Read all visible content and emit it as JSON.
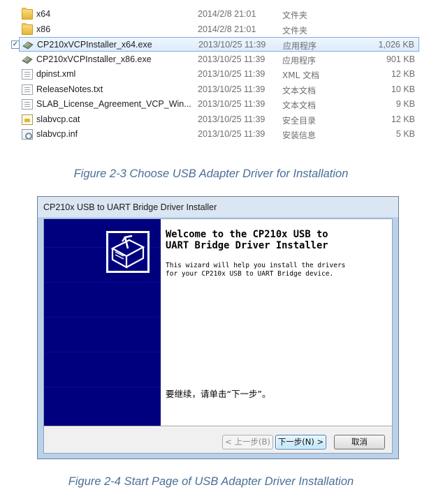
{
  "files": [
    {
      "name": "x64",
      "date": "2014/2/8 21:01",
      "type": "文件夹",
      "size": "",
      "icon": "folder-icon",
      "selected": false
    },
    {
      "name": "x86",
      "date": "2014/2/8 21:01",
      "type": "文件夹",
      "size": "",
      "icon": "folder-icon",
      "selected": false
    },
    {
      "name": "CP210xVCPInstaller_x64.exe",
      "date": "2013/10/25 11:39",
      "type": "应用程序",
      "size": "1,026 KB",
      "icon": "installer-exe-icon",
      "selected": true
    },
    {
      "name": "CP210xVCPInstaller_x86.exe",
      "date": "2013/10/25 11:39",
      "type": "应用程序",
      "size": "901 KB",
      "icon": "installer-exe-icon",
      "selected": false
    },
    {
      "name": "dpinst.xml",
      "date": "2013/10/25 11:39",
      "type": "XML 文档",
      "size": "12 KB",
      "icon": "xml-document-icon",
      "selected": false
    },
    {
      "name": "ReleaseNotes.txt",
      "date": "2013/10/25 11:39",
      "type": "文本文档",
      "size": "10 KB",
      "icon": "text-document-icon",
      "selected": false
    },
    {
      "name": "SLAB_License_Agreement_VCP_Win...",
      "date": "2013/10/25 11:39",
      "type": "文本文档",
      "size": "9 KB",
      "icon": "text-document-icon",
      "selected": false
    },
    {
      "name": "slabvcp.cat",
      "date": "2013/10/25 11:39",
      "type": "安全目录",
      "size": "12 KB",
      "icon": "security-catalog-icon",
      "selected": false
    },
    {
      "name": "slabvcp.inf",
      "date": "2013/10/25 11:39",
      "type": "安装信息",
      "size": "5 KB",
      "icon": "setup-information-icon",
      "selected": false
    }
  ],
  "checkbox_mark": "✓",
  "captions": {
    "fig_2_3": "Figure 2-3 Choose USB Adapter Driver for Installation",
    "fig_2_4": "Figure 2-4 Start Page of USB Adapter Driver Installation"
  },
  "dialog": {
    "title": "CP210x USB to UART Bridge Driver Installer",
    "welcome": "Welcome to the CP210x USB to\nUART Bridge Driver Installer",
    "description": "This wizard will help you install the drivers\nfor your CP210x USB to UART Bridge device.",
    "prompt": "要继续，请单击“下一步”。",
    "buttons": {
      "back": "< 上一步(B)",
      "next": "下一步(N) >",
      "cancel": "取消"
    },
    "banner_color": "#00007e"
  },
  "colors": {
    "selection_border": "#84acdd",
    "caption_text": "#4a6e98",
    "default_button_border": "#3c7fb1"
  }
}
